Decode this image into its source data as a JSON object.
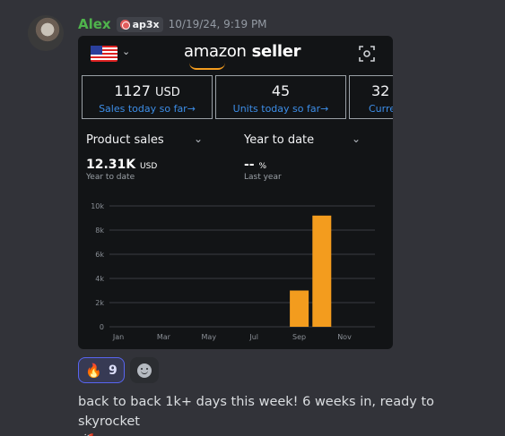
{
  "message": {
    "author": "Alex",
    "clan_tag": "ap3x",
    "timestamp": "10/19/24, 9:19 PM",
    "text": "back to back 1k+ days this week! 6 weeks in, ready to skyrocket",
    "text_emoji": "🚀"
  },
  "reactions": [
    {
      "emoji": "🔥",
      "count": "9"
    }
  ],
  "screenshot": {
    "brand_regular": "amazon",
    "brand_bold": " seller",
    "stats": [
      {
        "value": "1127",
        "unit": "USD",
        "label": "Sales today so far→"
      },
      {
        "value": "45",
        "unit": "",
        "label": "Units today so far→"
      },
      {
        "value": "32",
        "unit": "",
        "label": "Curre"
      }
    ],
    "dropdowns": {
      "metric": "Product sales",
      "period": "Year to date"
    },
    "metric_left": {
      "value": "12.31K",
      "unit": "USD",
      "label": "Year to date"
    },
    "metric_right": {
      "value": "--",
      "unit": "%",
      "label": "Last year"
    }
  },
  "colors": {
    "bar": "#f39c1e",
    "link": "#3d8ee8",
    "username": "#4fb34c",
    "reaction_border": "#5865f2"
  },
  "chart_data": {
    "type": "bar",
    "x_tick_labels": [
      "Jan",
      "Mar",
      "May",
      "Jul",
      "Sep",
      "Nov"
    ],
    "y_tick_labels": [
      "0",
      "2k",
      "4k",
      "6k",
      "8k",
      "10k"
    ],
    "ylim": [
      0,
      10000
    ],
    "grid": true,
    "series": [
      {
        "values": [
          {
            "month": "Sep",
            "value": 3000
          },
          {
            "month": "Oct",
            "value": 9200
          }
        ]
      }
    ]
  }
}
